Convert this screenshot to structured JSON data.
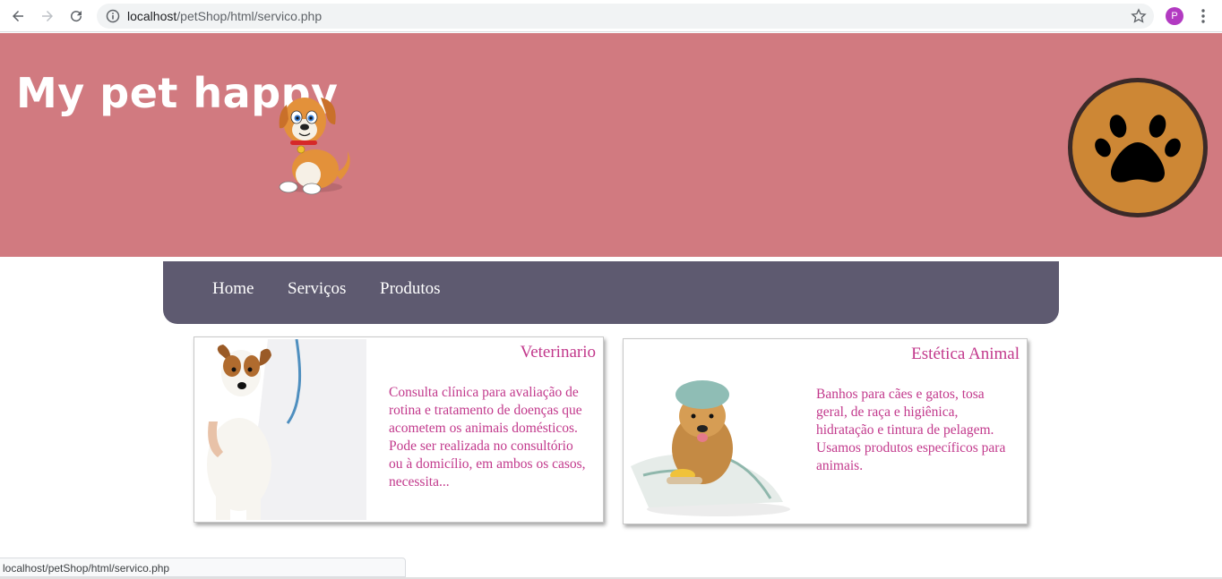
{
  "browser": {
    "url_host": "localhost",
    "url_path": "/petShop/html/servico.php",
    "profile_initial": "P"
  },
  "header": {
    "logo_text": "My pet happy",
    "background": "#d17a80"
  },
  "nav": {
    "items": [
      {
        "label": "Home"
      },
      {
        "label": "Serviços"
      },
      {
        "label": "Produtos"
      }
    ],
    "background": "#5e5a70"
  },
  "cards": [
    {
      "title": "Veterinario",
      "description": "Consulta clínica para avaliação de rotina e tratamento de doenças que acometem os animais domésticos. Pode ser realizada no consultório ou à domicílio, em ambos os casos, necessita...",
      "image": "vet-dog-photo"
    },
    {
      "title": "Estética Animal",
      "description": "Banhos para cães e gatos, tosa geral, de raça e higiênica, hidratação e tintura de pelagem. Usamos produtos específicos para animais.",
      "image": "groomed-dog-photo"
    }
  ],
  "accent_color": "#c2398c",
  "status_bar": {
    "text": "localhost/petShop/html/servico.php"
  }
}
